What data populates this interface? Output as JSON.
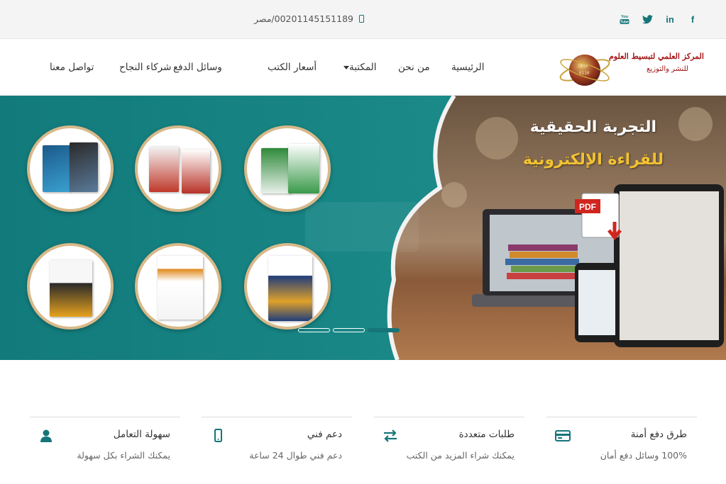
{
  "topbar": {
    "social": [
      {
        "name": "facebook-icon",
        "glyph": "f"
      },
      {
        "name": "linkedin-icon",
        "glyph": "in"
      },
      {
        "name": "twitter-icon",
        "glyph": "t"
      },
      {
        "name": "youtube-icon",
        "glyph": "You"
      }
    ],
    "contact": "00201145151189/مصر"
  },
  "logo": {
    "line1": "المركز العلمي لتبسيط العلوم",
    "line2": "للنشر والتوزيع"
  },
  "nav": {
    "items": [
      {
        "label": "الرئيسية"
      },
      {
        "label": "من نحن"
      },
      {
        "label": "المكتبة"
      },
      {
        "label": "أسعار الكتب"
      },
      {
        "label": "وسائل الدفع"
      },
      {
        "label": "شركاء النجاح"
      },
      {
        "label": "تواصل معنا"
      }
    ]
  },
  "hero": {
    "title": "التجربة الحقيقية",
    "subtitle": "للقراءة الإلكترونية",
    "pdf_label": "PDF",
    "slides": 3,
    "active_slide": 3,
    "colors": {
      "teal": "#167a7c",
      "gold": "#f2c230",
      "accent": "#16757a"
    }
  },
  "features": [
    {
      "title": "طرق دفع أمنة",
      "desc": "100% وسائل دفع أمان",
      "icon": "credit-card-icon"
    },
    {
      "title": "طلبات متعددة",
      "desc": "يمكنك شراء المزيد من الكتب",
      "icon": "exchange-arrows-icon"
    },
    {
      "title": "دعم فني",
      "desc": "دعم فني طوال 24 ساعة",
      "icon": "mobile-icon"
    },
    {
      "title": "سهولة التعامل",
      "desc": "يمكنك الشراء بكل سهولة",
      "icon": "user-icon"
    }
  ]
}
